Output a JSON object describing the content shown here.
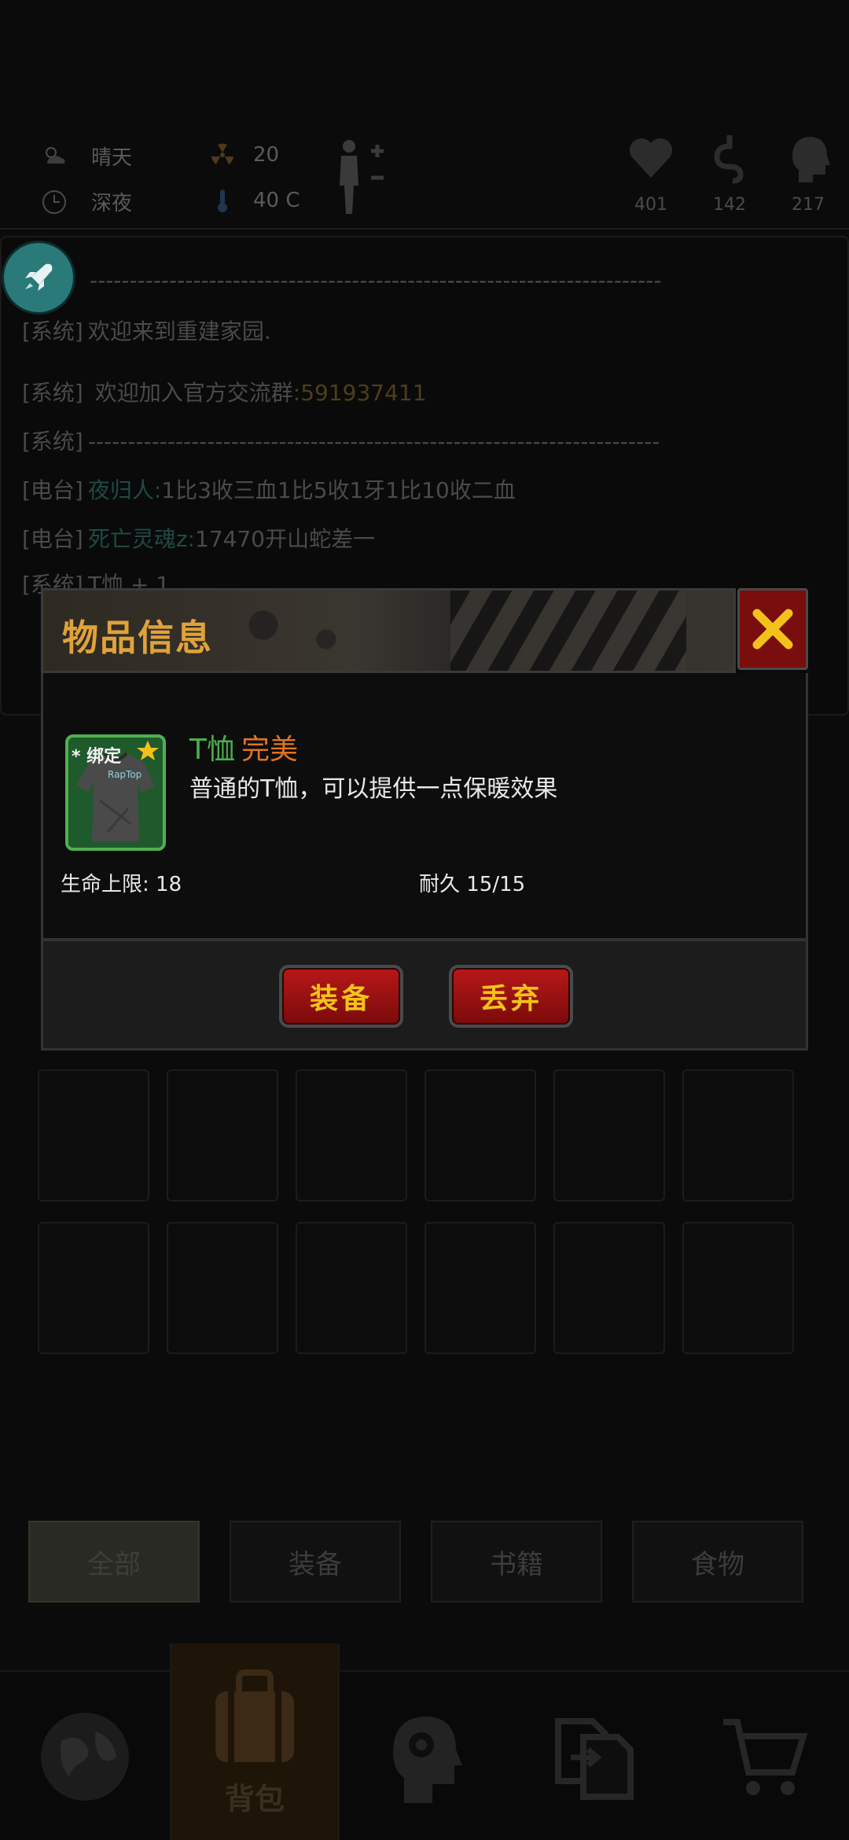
{
  "status": {
    "weather": "晴天",
    "time_of_day": "深夜",
    "radiation": "20",
    "temperature": "40 C",
    "health": "401",
    "stomach": "142",
    "mind": "217"
  },
  "log": [
    {
      "tag": "",
      "name": "",
      "text": "------------------------------------------------------------------------",
      "num": ""
    },
    {
      "tag": "[系统]",
      "name": "",
      "text": "欢迎来到重建家园.",
      "num": ""
    },
    {
      "tag": "[系统]",
      "name": "",
      "text": " 欢迎加入官方交流群",
      "num": ":591937411"
    },
    {
      "tag": "[系统]",
      "name": "",
      "text": "------------------------------------------------------------------------",
      "num": ""
    },
    {
      "tag": "[电台]",
      "name": "夜归人:",
      "text": "1比3收三血1比5收1牙1比10收二血",
      "num": ""
    },
    {
      "tag": "[电台]",
      "name": "死亡灵魂z:",
      "text": "17470开山蛇差一",
      "num": ""
    },
    {
      "tag": "[系统]",
      "name": "",
      "text": "T恤 + 1",
      "num": ""
    }
  ],
  "categories": [
    "全部",
    "装备",
    "书籍",
    "食物"
  ],
  "nav": {
    "backpack_label": "背包"
  },
  "dialog": {
    "title": "物品信息",
    "item": {
      "bind_tag": "* 绑定",
      "brand": "RapTop",
      "name": "T恤",
      "quality": "完美",
      "description": "普通的T恤，可以提供一点保暖效果",
      "stat_hp": "生命上限: 18",
      "stat_durability": "耐久 15/15"
    },
    "equip_label": "装备",
    "drop_label": "丢弃"
  },
  "colors": {
    "title_gold": "#e0a23a",
    "item_name_green": "#49b04c",
    "quality_orange": "#e2741a",
    "button_red": "#b81818",
    "button_text": "#f2c21a"
  }
}
